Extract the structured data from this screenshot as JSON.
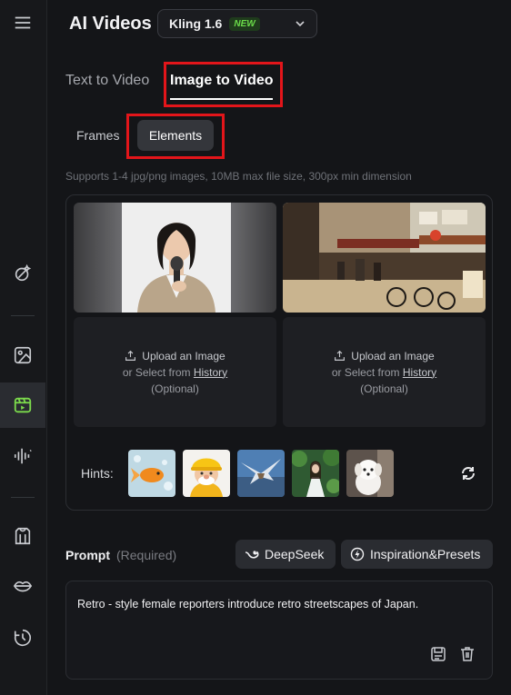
{
  "header": {
    "title": "AI Videos",
    "model": "Kling 1.6",
    "model_badge": "NEW"
  },
  "sidebar": {
    "items": [
      {
        "icon": "menu-icon"
      },
      {
        "icon": "magic-wand-icon"
      },
      {
        "icon": "image-icon"
      },
      {
        "icon": "video-icon",
        "active": true
      },
      {
        "icon": "audio-wave-icon"
      },
      {
        "icon": "shirt-icon"
      },
      {
        "icon": "lips-icon"
      },
      {
        "icon": "history-icon"
      }
    ]
  },
  "tabs": {
    "text_to_video": "Text to Video",
    "image_to_video": "Image to Video"
  },
  "subtabs": {
    "frames": "Frames",
    "elements": "Elements"
  },
  "supports_text": "Supports 1-4 jpg/png images, 10MB max file size, 300px min dimension",
  "upload": {
    "line1": "Upload an Image",
    "line2_prefix": "or Select from ",
    "line2_link": "History",
    "line3": "(Optional)"
  },
  "hints": {
    "label": "Hints:",
    "thumbs": [
      "goldfish",
      "cartoon-worker",
      "eagle",
      "woman-in-forest",
      "white-puppy"
    ]
  },
  "prompt": {
    "label": "Prompt",
    "required": "(Required)",
    "deepseek_label": "DeepSeek",
    "inspiration_label": "Inspiration&Presets",
    "text": "Retro - style female reporters introduce retro streetscapes of Japan."
  },
  "colors": {
    "accent_green": "#7cdb4c",
    "highlight_red": "#e3151a",
    "background": "#141518"
  }
}
